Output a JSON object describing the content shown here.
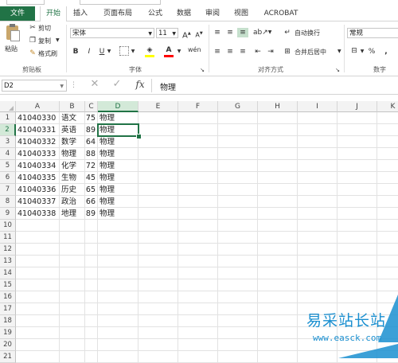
{
  "tabs": [
    {
      "id": "file",
      "label": "文件"
    },
    {
      "id": "home",
      "label": "开始"
    },
    {
      "id": "insert",
      "label": "插入"
    },
    {
      "id": "layout",
      "label": "页面布局"
    },
    {
      "id": "formulas",
      "label": "公式"
    },
    {
      "id": "data",
      "label": "数据"
    },
    {
      "id": "review",
      "label": "审阅"
    },
    {
      "id": "view",
      "label": "视图"
    },
    {
      "id": "acrobat",
      "label": "ACROBAT"
    }
  ],
  "ribbon": {
    "clipboard": {
      "paste": "粘贴",
      "cut": "剪切",
      "copy": "复制",
      "format_painter": "格式刷",
      "label": "剪贴板"
    },
    "font": {
      "name": "宋体",
      "size": "11",
      "grow": "A",
      "shrink": "A",
      "bold": "B",
      "italic": "I",
      "underline": "U",
      "label": "字体"
    },
    "alignment": {
      "wrap": "自动换行",
      "merge": "合并后居中",
      "label": "对齐方式"
    },
    "number": {
      "format": "常规",
      "percent": "%",
      "comma": ",",
      "label": "数字"
    }
  },
  "formula_bar": {
    "name_box": "D2",
    "cancel": "✕",
    "enter": "✓",
    "fx": "fx",
    "content": "物理"
  },
  "columns": [
    "A",
    "B",
    "C",
    "D",
    "E",
    "F",
    "G",
    "H",
    "I",
    "J",
    "K"
  ],
  "rows": [
    "1",
    "2",
    "3",
    "4",
    "5",
    "6",
    "7",
    "8",
    "9",
    "10",
    "11",
    "12",
    "13",
    "14",
    "15",
    "16",
    "17",
    "18",
    "19",
    "20",
    "21"
  ],
  "data": [
    [
      "41040330",
      "语文",
      "75",
      "物理"
    ],
    [
      "41040331",
      "英语",
      "89",
      "物理"
    ],
    [
      "41040332",
      "数学",
      "64",
      "物理"
    ],
    [
      "41040333",
      "物理",
      "88",
      "物理"
    ],
    [
      "41040334",
      "化学",
      "72",
      "物理"
    ],
    [
      "41040335",
      "生物",
      "45",
      "物理"
    ],
    [
      "41040336",
      "历史",
      "65",
      "物理"
    ],
    [
      "41040337",
      "政治",
      "66",
      "物理"
    ],
    [
      "41040338",
      "地理",
      "89",
      "物理"
    ]
  ],
  "watermark": {
    "title": "易采站长站",
    "url": "www.easck.com",
    "color": "#1a8fd0"
  },
  "colors": {
    "accent": "#217346"
  }
}
